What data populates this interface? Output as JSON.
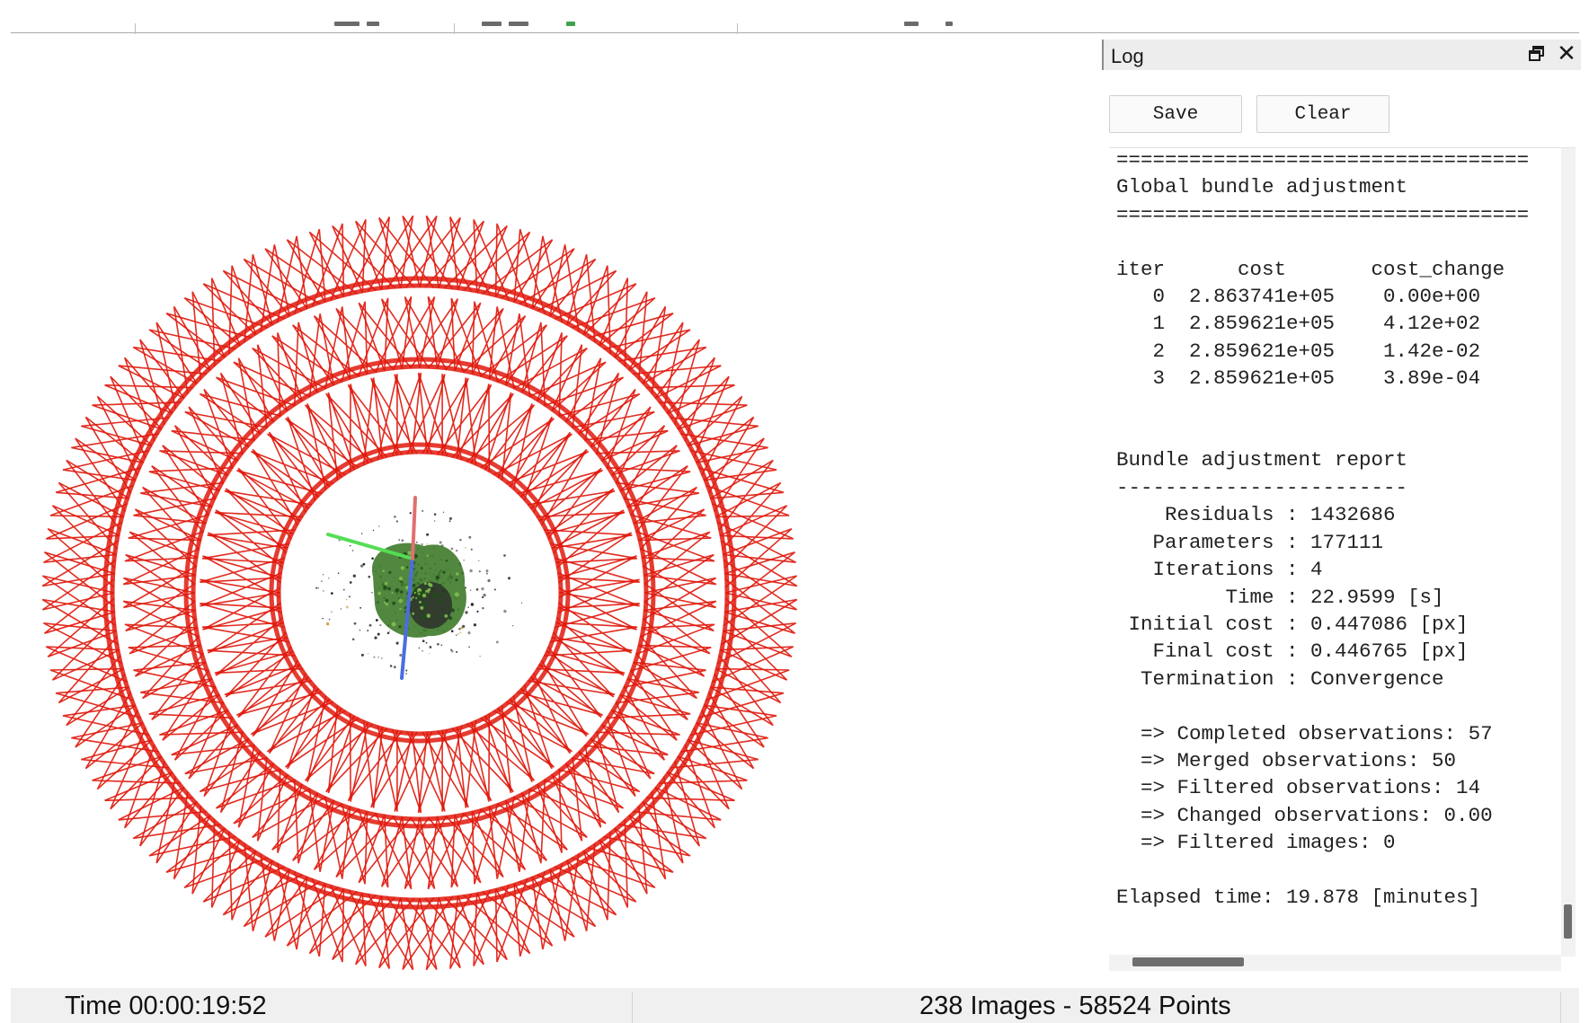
{
  "log": {
    "title": "Log",
    "float_icon": "restore-window-icon",
    "close_icon": "close-icon",
    "close_glyph": "✕",
    "save_label": "Save",
    "clear_label": "Clear",
    "text": "==================================\nGlobal bundle adjustment\n==================================\n\niter      cost       cost_change\n   0  2.863741e+05    0.00e+00\n   1  2.859621e+05    4.12e+02\n   2  2.859621e+05    1.42e-02\n   3  2.859621e+05    3.89e-04\n\n\nBundle adjustment report\n------------------------\n    Residuals : 1432686\n   Parameters : 177111\n   Iterations : 4\n         Time : 22.9599 [s]\n Initial cost : 0.447086 [px]\n   Final cost : 0.446765 [px]\n  Termination : Convergence\n\n  => Completed observations: 57\n  => Merged observations: 50\n  => Filtered observations: 14\n  => Changed observations: 0.00\n  => Filtered images: 0\n\nElapsed time: 19.878 [minutes]"
  },
  "status": {
    "time": "Time 00:00:19:52",
    "counts": "238 Images - 58524 Points"
  },
  "viewport": {
    "camera_count": 238,
    "camera_color": "#e01a0e",
    "axis_colors": {
      "x": "#e07070",
      "y": "#55dd55",
      "z": "#4a6de0"
    },
    "model_color": "#3e7a2a"
  }
}
